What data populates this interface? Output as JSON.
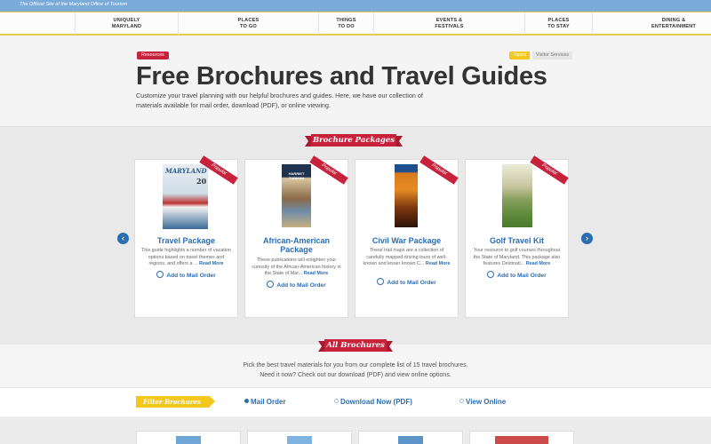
{
  "topbar": {
    "tagline": "The Official Site of the Maryland Office of Tourism"
  },
  "nav": [
    {
      "label": "UNIQUELY\nMARYLAND"
    },
    {
      "label": "PLACES\nTO GO"
    },
    {
      "label": "THINGS\nTO DO"
    },
    {
      "label": "EVENTS &\nFESTIVALS"
    },
    {
      "label": "PLACES\nTO STAY"
    },
    {
      "label": "DINING &\nENTERTAINMENT"
    }
  ],
  "hero": {
    "breadcrumb": "Resources",
    "topics_label": "Topics",
    "topic": "Visitor Services",
    "title": "Free Brochures and Travel Guides",
    "intro": "Customize your travel planning with our helpful brochures and guides. Here, we have our collection of materials available for mail order, download (PDF), or online viewing."
  },
  "packages": {
    "heading": "Brochure Packages",
    "cards": [
      {
        "badge": "Popular",
        "cover_text": "MARYLAND",
        "title": "Travel Package",
        "desc": "This guide highlights a number of vacation options based on travel themes and regions, and offers a ...",
        "more": "Read More",
        "action": "Add to Mail Order"
      },
      {
        "badge": "Popular",
        "cover_text": "HARRIET TUBMAN",
        "title": "African-American Package",
        "desc": "These publications will enlighten your curiosity of the African-American history in the State of Mar...",
        "more": "Read More",
        "action": "Add to Mail Order"
      },
      {
        "badge": "Popular",
        "cover_text": "",
        "title": "Civil War Package",
        "desc": "These trail maps are a collection of carefully mapped driving tours of well-known and lesser known C...",
        "more": "Read More",
        "action": "Add to Mail Order"
      },
      {
        "badge": "Popular",
        "cover_text": "",
        "title": "Golf Travel Kit",
        "desc": "Your resource to golf courses throughout the State of Maryland. This package also features Destinati...",
        "more": "Read More",
        "action": "Add to Mail Order"
      }
    ],
    "prev_icon": "arrow-left-icon",
    "next_icon": "arrow-right-icon"
  },
  "all_brochures": {
    "heading": "All Brochures",
    "line1": "Pick the best travel materials for you from our complete list of 15 travel brochures.",
    "line2": "Need it now? Check out our download (PDF) and view online options."
  },
  "filters": {
    "label": "Filter Brochures",
    "options": [
      {
        "label": "Mail Order",
        "selected": true
      },
      {
        "label": "Download Now (PDF)",
        "selected": false
      },
      {
        "label": "View Online",
        "selected": false
      }
    ]
  },
  "colors": {
    "accent_red": "#c8213c",
    "link_blue": "#2a6db2",
    "accent_yellow": "#f4c71c",
    "top_blue": "#7aaad8"
  }
}
